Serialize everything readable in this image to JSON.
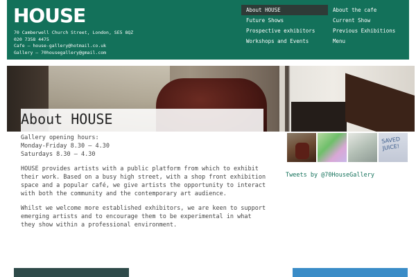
{
  "header": {
    "logo": "HOUSE",
    "contact": [
      "70 Camberwell Church Street, London, SE5 8QZ",
      "020 7358 4475",
      "Cafe — house-gallery@hotmail.co.uk",
      "Gallery — 70housegallery@gmail.com"
    ],
    "nav": [
      "About HOUSE",
      "About the cafe",
      "Future Shows",
      "Current Show",
      "Prospective exhibitors",
      "Previous Exhibitions",
      "Workshops and Events",
      "Menu"
    ],
    "active_nav": "About HOUSE"
  },
  "main": {
    "title": "About HOUSE",
    "hours": [
      "Gallery opening hours:",
      "Monday-Friday 8.30 – 4.30",
      "Saturdays 8.30 – 4.30"
    ],
    "paragraphs": [
      "HOUSE provides artists with a public platform from which to exhibit their work. Based on a busy high street, with a shop front exhibition space and a popular café, we give artists the opportunity to interact with both the community and the contemporary art audience.",
      "Whilst we welcome more established exhibitors, we are keen to support emerging artists and to encourage them to be experimental in what they show within a professional environment."
    ]
  },
  "sidebar": {
    "thumb4_text": "SAVED\nJUICE!",
    "tweets_link": "Tweets by @70HouseGallery"
  },
  "colors": {
    "header_bg": "#13715a",
    "nav_active_bg": "#2e3b37",
    "link": "#13715a",
    "bar_left": "#2e4a49",
    "bar_right": "#3a8cc7"
  }
}
